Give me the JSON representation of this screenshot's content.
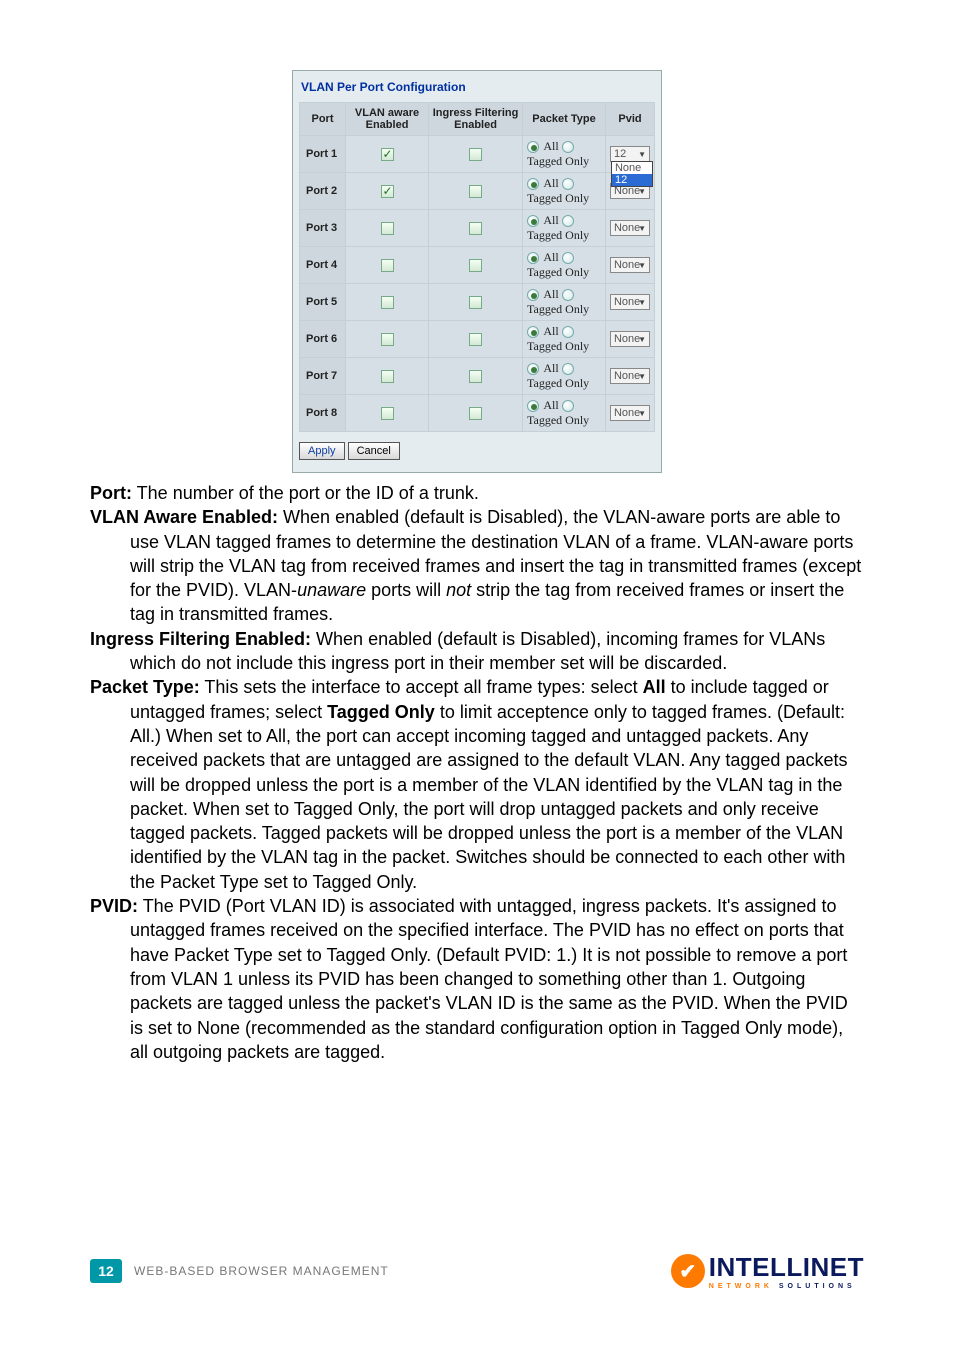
{
  "screenshot": {
    "title": "VLAN Per Port Configuration",
    "headers": [
      "Port",
      "VLAN aware Enabled",
      "Ingress Filtering Enabled",
      "Packet Type",
      "Pvid"
    ],
    "packet_labels": {
      "all": "All",
      "tagged": "Tagged Only"
    },
    "rows": [
      {
        "port": "Port 1",
        "aware": true,
        "ingress": false,
        "packet": "all",
        "pvid": "12",
        "open": true,
        "dd": [
          "None",
          "12"
        ]
      },
      {
        "port": "Port 2",
        "aware": true,
        "ingress": false,
        "packet": "all",
        "pvid": "None"
      },
      {
        "port": "Port 3",
        "aware": false,
        "ingress": false,
        "packet": "all",
        "pvid": "None"
      },
      {
        "port": "Port 4",
        "aware": false,
        "ingress": false,
        "packet": "all",
        "pvid": "None"
      },
      {
        "port": "Port 5",
        "aware": false,
        "ingress": false,
        "packet": "all",
        "pvid": "None"
      },
      {
        "port": "Port 6",
        "aware": false,
        "ingress": false,
        "packet": "all",
        "pvid": "None"
      },
      {
        "port": "Port 7",
        "aware": false,
        "ingress": false,
        "packet": "all",
        "pvid": "None"
      },
      {
        "port": "Port 8",
        "aware": false,
        "ingress": false,
        "packet": "all",
        "pvid": "None"
      }
    ],
    "buttons": {
      "apply": "Apply",
      "cancel": "Cancel"
    }
  },
  "body": {
    "port_lead": "Port:",
    "port_text": " The number of the port or the ID of a trunk.",
    "aware_lead": "VLAN Aware Enabled:",
    "aware_text_a": " When enabled (default is Disabled), the VLAN-aware ports are able to use VLAN tagged frames to determine the destination VLAN of a frame. VLAN-aware ports will strip the VLAN tag from received frames and insert the tag in transmitted frames (except for the PVID). VLAN-",
    "aware_unaware": "unaware",
    "aware_text_b": " ports will ",
    "aware_not": "not",
    "aware_text_c": " strip the tag from received frames or insert the tag in transmitted frames.",
    "ingress_lead": "Ingress Filtering Enabled:",
    "ingress_text": " When enabled (default is Disabled), incoming frames for VLANs which do not include this ingress port in their member set will be discarded.",
    "packet_lead": "Packet Type:",
    "packet_text_a": " This sets the interface to accept all frame types: select ",
    "packet_all": "All",
    "packet_text_b": " to include tagged or untagged frames; select ",
    "packet_tagged": "Tagged Only",
    "packet_text_c": " to limit acceptence only to tagged frames. (Default: All.) When set to All, the port can accept incoming tagged and untagged packets. Any received packets that are untagged are assigned to the default VLAN. Any tagged packets will be dropped unless the port is a member of the VLAN identified by the VLAN tag in the packet. When set to Tagged Only, the port will drop untagged packets and only receive tagged packets. Tagged packets will be dropped unless the port is a member of the VLAN identified by the VLAN tag in the packet. Switches should be connected to each other with the Packet Type set to Tagged Only.",
    "pvid_lead": "PVID:",
    "pvid_text": " The PVID (Port VLAN ID) is associated with untagged, ingress packets. It's assigned to untagged frames received on the specified interface. The PVID has no effect on ports that have Packet Type set to Tagged Only. (Default PVID: 1.) It is not possible to remove a port from VLAN 1 unless its PVID has been changed to something other than 1. Outgoing packets are tagged unless the packet's VLAN ID is the same as the PVID. When the PVID is set to None (recommended as the standard configuration option in Tagged Only mode), all outgoing packets are tagged."
  },
  "footer": {
    "page": "12",
    "section": "WEB-BASED BROWSER MANAGEMENT",
    "brand": "INTELLINET",
    "brand_sub_a": "NETWORK ",
    "brand_sub_b": "SOLUTIONS"
  }
}
